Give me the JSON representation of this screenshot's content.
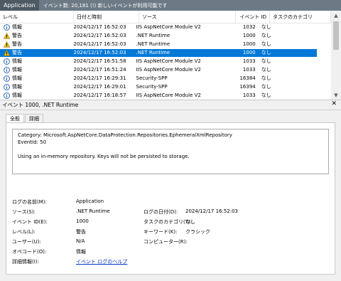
{
  "titlebar": {
    "app": "Application",
    "info": "イベント数: 20,181 (!) 新しいイベントが利用可能です"
  },
  "columns": [
    "レベル",
    "日付と時刻",
    "ソース",
    "イベント ID",
    "タスクのカテゴリ"
  ],
  "rows": [
    {
      "level": "情報",
      "icon": "info",
      "date": "2024/12/17 16:52:03",
      "source": "IIS AspNetCore Module V2",
      "id": "1032",
      "task": "なし"
    },
    {
      "level": "警告",
      "icon": "warning",
      "date": "2024/12/17 16:52:03",
      "source": ".NET Runtime",
      "id": "1000",
      "task": "なし"
    },
    {
      "level": "警告",
      "icon": "warning",
      "date": "2024/12/17 16:52:03",
      "source": ".NET Runtime",
      "id": "1000",
      "task": "なし"
    },
    {
      "level": "警告",
      "icon": "warning",
      "date": "2024/12/17 16:52:03",
      "source": ".NET Runtime",
      "id": "1000",
      "task": "なし",
      "selected": true
    },
    {
      "level": "情報",
      "icon": "info",
      "date": "2024/12/17 16:51:58",
      "source": "IIS AspNetCore Module V2",
      "id": "1033",
      "task": "なし"
    },
    {
      "level": "情報",
      "icon": "info",
      "date": "2024/12/17 16:51:24",
      "source": "IIS AspNetCore Module V2",
      "id": "1033",
      "task": "なし"
    },
    {
      "level": "情報",
      "icon": "info",
      "date": "2024/12/17 16:29:31",
      "source": "Security-SPP",
      "id": "16384",
      "task": "なし"
    },
    {
      "level": "情報",
      "icon": "info",
      "date": "2024/12/17 16:29:01",
      "source": "Security-SPP",
      "id": "16394",
      "task": "なし"
    },
    {
      "level": "情報",
      "icon": "info",
      "date": "2024/12/17 16:18:57",
      "source": "IIS AspNetCore Module V2",
      "id": "1033",
      "task": "なし"
    }
  ],
  "detail": {
    "title": "イベント 1000, .NET Runtime",
    "tabs": [
      "全般",
      "詳細"
    ],
    "message": [
      "Category: Microsoft.AspNetCore.DataProtection.Repositories.EphemeralXmlRepository",
      "EventId: 50",
      "",
      "Using an in-memory repository. Keys will not be persisted to storage."
    ],
    "props": {
      "log_name_label": "ログの名前(M):",
      "log_name": "Application",
      "source_label": "ソース(S):",
      "source": ".NET Runtime",
      "logged_label": "ログの日付(D):",
      "logged": "2024/12/17 16:52:03",
      "event_id_label": "イベント ID(E):",
      "event_id": "1000",
      "task_label": "タスクのカテゴリ(Y):",
      "task": "なし",
      "level_label": "レベル(L):",
      "level": "警告",
      "keywords_label": "キーワード(K):",
      "keywords": "クラシック",
      "user_label": "ユーザー(U):",
      "user": "N/A",
      "computer_label": "コンピューター(R):",
      "computer": "",
      "opcode_label": "オペコード(O):",
      "opcode": "情報",
      "more_label": "詳細情報(I):",
      "more_link": "イベント ログのヘルプ"
    }
  },
  "colors": {
    "selection": "#0078d7",
    "titlebar": "#6d7a86",
    "link": "#0033cc"
  }
}
